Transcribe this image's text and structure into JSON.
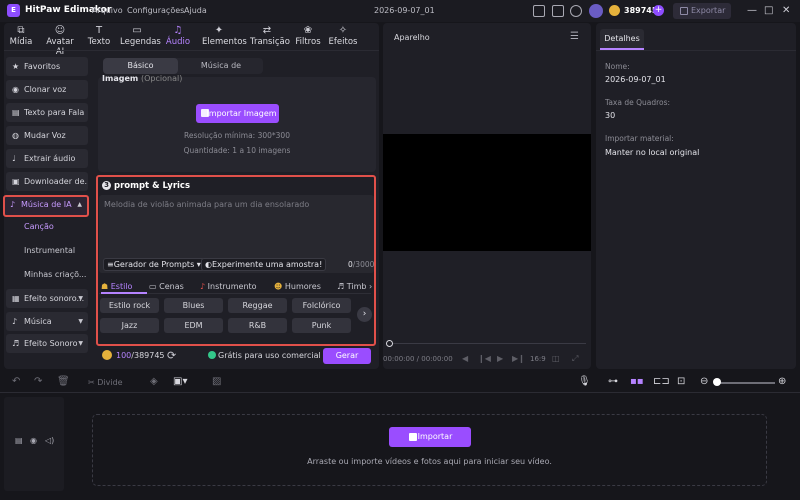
{
  "app": {
    "title": "HitPaw Edimakor",
    "project": "2026-09-07_01"
  },
  "menu": [
    "Arquivo",
    "Configurações",
    "Ajuda"
  ],
  "account": {
    "credits": "389745",
    "export_label": "Exportar"
  },
  "toolbar": [
    "Mídia",
    "Avatar AI",
    "Texto",
    "Legendas",
    "Áudio",
    "Elementos",
    "Transição",
    "Filtros",
    "Efeitos"
  ],
  "sidebar": {
    "items": [
      "Favoritos",
      "Clonar voz",
      "Texto para Fala",
      "Mudar Voz",
      "Extrair áudio",
      "Downloader de...",
      "Música de IA"
    ],
    "subitems": [
      "Canção",
      "Instrumental",
      "Minhas criaçõ..."
    ],
    "more": [
      "Efeito sonoro...",
      "Música",
      "Efeito Sonoro"
    ]
  },
  "mode": {
    "basic": "Básico",
    "reference": "Música de referência"
  },
  "image": {
    "label": "Imagem",
    "optional": "(Opcional)",
    "import_btn": "Importar Imagem",
    "resolution": "Resolução mínima: 300*300",
    "quantity": "Quantidade: 1 a 10 imagens"
  },
  "prompt": {
    "number": "3",
    "title": "prompt & Lyrics",
    "placeholder": "Melodia de violão animada para um dia ensolarado",
    "generator": "Gerador de Prompts",
    "sample": "Experimente uma amostra!",
    "count": "0",
    "max": "/3000"
  },
  "categories": [
    "Estilo",
    "Cenas",
    "Instrumento",
    "Humores",
    "Timb"
  ],
  "styles": [
    "Estilo rock",
    "Blues",
    "Reggae",
    "Folclórico",
    "Jazz",
    "EDM",
    "R&B",
    "Punk"
  ],
  "footer": {
    "credits_used": "100",
    "credits_total": "/389745",
    "free": "Grátis para uso comercial",
    "generate": "Gerar"
  },
  "player": {
    "title": "Aparelho",
    "time": "00:00:00 / 00:00:00",
    "ratio": "16:9"
  },
  "details": {
    "tab": "Detalhes",
    "name_label": "Nome:",
    "name": "2026-09-07_01",
    "fps_label": "Taxa de Quadros:",
    "fps": "30",
    "import_label": "Importar material:",
    "import_value": "Manter no local original"
  },
  "timeline": {
    "divide": "Divide",
    "import_btn": "Importar",
    "drop_text": "Arraste ou importe vídeos e fotos aqui para iniciar seu vídeo."
  }
}
